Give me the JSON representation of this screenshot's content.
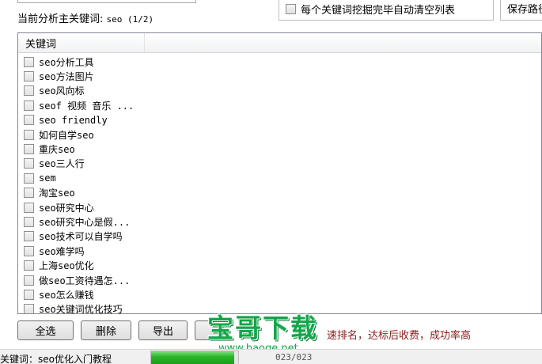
{
  "header": {
    "current_keyword_label": "当前分析主关键词:",
    "current_keyword_value": "seo (1/2)",
    "auto_clear_label": "每个关键词挖掘完毕自动清空列表",
    "save_path_label": "保存路径"
  },
  "list": {
    "column_header": "关键词",
    "items": [
      "seo分析工具",
      "seo方法图片",
      "seo风向标",
      "seof 视频 音乐 ...",
      "seo friendly",
      "如何自学seo",
      "重庆seo",
      "seo三人行",
      "sem",
      "淘宝seo",
      "seo研究中心",
      "seo研究中心是假...",
      "seo技术可以自学吗",
      "seo难学吗",
      "上海seo优化",
      "做seo工资待遇怎...",
      "seo怎么赚钱",
      "seo关键词优化技巧"
    ]
  },
  "buttons": {
    "select_all": "全选",
    "delete": "删除",
    "export": "导出"
  },
  "promo_text": "速排名，达标后收费，成功率高",
  "watermark": {
    "title": "宝哥下载",
    "url": "www.baoge.net"
  },
  "status": {
    "label": "关键词：seo优化入门教程",
    "progress_fraction": 0.95,
    "progress_text": "023/023"
  },
  "colors": {
    "promo": "#8a1b1b",
    "watermark_green": "#13a54a",
    "progress_green": "#27b427"
  }
}
